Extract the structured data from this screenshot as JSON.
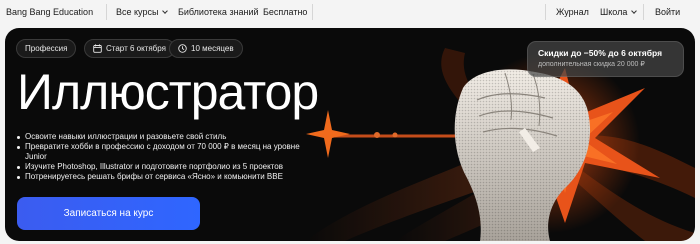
{
  "nav": {
    "brand": "Bang Bang Education",
    "all_courses": "Все курсы",
    "library": "Библиотека знаний",
    "free": "Бесплатно",
    "journal": "Журнал",
    "school": "Школа",
    "login": "Войти"
  },
  "hero": {
    "chips": {
      "profession": "Профессия",
      "start": "Старт 6 октября",
      "duration": "10 месяцев"
    },
    "title": "Иллюстратор",
    "bullets": [
      "Освоите навыки иллюстрации и разовьете свой стиль",
      "Превратите хобби в профессию с доходом от 70 000 ₽ в месяц на уровне Junior",
      "Изучите Photoshop, Illustrator и подготовите портфолио из 5 проектов",
      "Потренируетесь решать брифы от сервиса «Ясно» и комьюнити BBE"
    ],
    "cta": "Записаться на курс",
    "promo": {
      "line1": "Скидки до −50% до 6 октября",
      "line2": "дополнительная скидка 20 000 ₽"
    }
  },
  "colors": {
    "hero_bg": "#0a0a0a",
    "cta": "#3b5cf0",
    "accent_orange": "#e85a1c"
  }
}
